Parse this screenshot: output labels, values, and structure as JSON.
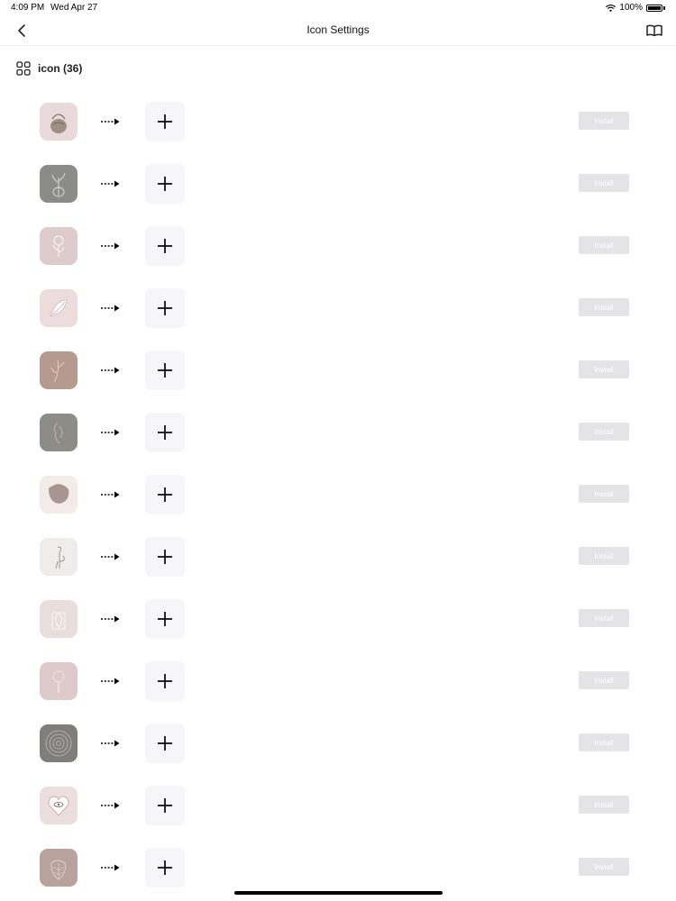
{
  "status_bar": {
    "time": "4:09 PM",
    "date": "Wed Apr 27",
    "battery": "100%"
  },
  "nav": {
    "title": "Icon Settings",
    "back_icon": "chevron-left-icon",
    "right_icon": "book-icon"
  },
  "section": {
    "icon": "grid-icon",
    "title": "icon (36)"
  },
  "colors": {
    "install_bg": "#e4e4e6",
    "add_bg": "#f6f6f8",
    "thumbs": [
      "#e8d9da",
      "#8b8b88",
      "#decbcb",
      "#ecdcdc",
      "#b59a8f",
      "#8e8c87",
      "#f2ebe7",
      "#eeedeb",
      "#e9dedc",
      "#dfcacb",
      "#7f7e7b",
      "#ebdedd",
      "#b8a29b"
    ]
  },
  "rows": [
    {
      "icon": "plant-basket-icon",
      "install_label": "Install"
    },
    {
      "icon": "plant-vase-icon",
      "install_label": "Install"
    },
    {
      "icon": "flower-line-icon",
      "install_label": "Install"
    },
    {
      "icon": "leaves-line-icon",
      "install_label": "Install"
    },
    {
      "icon": "branch-line-icon",
      "install_label": "Install"
    },
    {
      "icon": "face-line-icon",
      "install_label": "Install"
    },
    {
      "icon": "abstract-shape-icon",
      "install_label": "Install"
    },
    {
      "icon": "flamingo-line-icon",
      "install_label": "Install"
    },
    {
      "icon": "leaf-vase-icon",
      "install_label": "Install"
    },
    {
      "icon": "dandelion-icon",
      "install_label": "Install"
    },
    {
      "icon": "circles-icon",
      "install_label": "Install"
    },
    {
      "icon": "heart-eye-icon",
      "install_label": "Install"
    },
    {
      "icon": "monstera-leaf-icon",
      "install_label": "Install"
    }
  ]
}
